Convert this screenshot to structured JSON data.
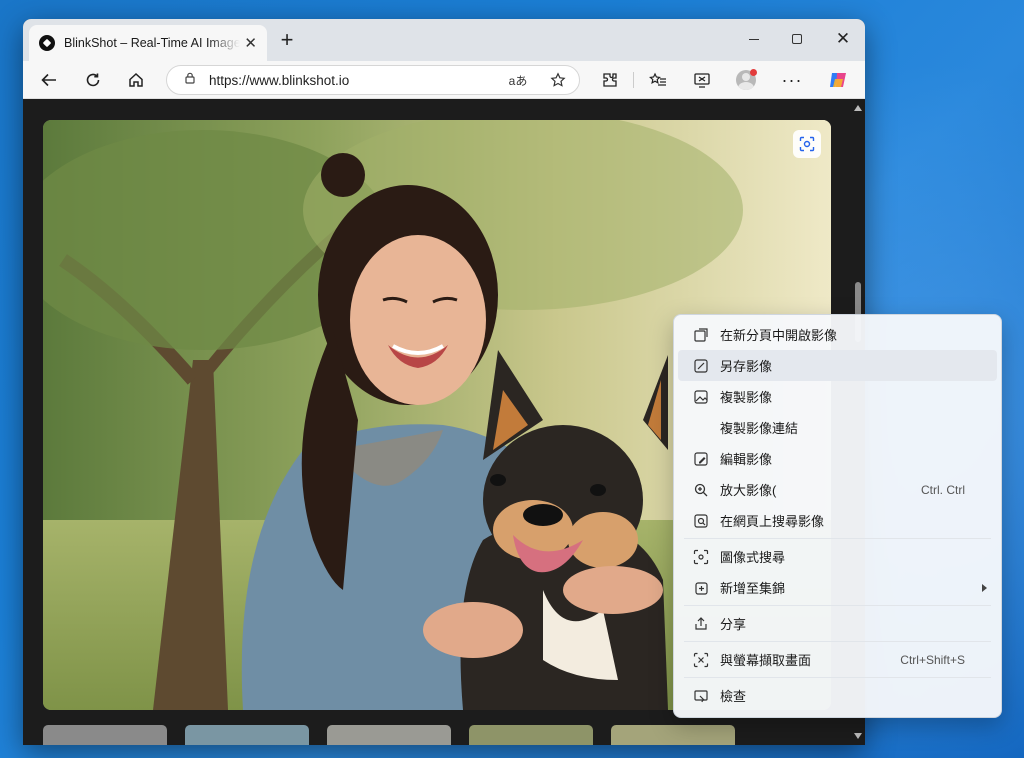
{
  "tab": {
    "title": "BlinkShot – Real-Time AI Image Generator"
  },
  "address": {
    "url": "https://www.blinkshot.io"
  },
  "icons": {
    "back": "back-arrow-icon",
    "refresh": "refresh-icon",
    "home": "home-icon",
    "lock": "site-info-icon",
    "read_aloud": "read-aloud-icon",
    "favorite": "star-icon",
    "extensions": "extensions-icon",
    "favorites": "favorites-icon",
    "collections": "screenshot-icon",
    "profile": "profile-avatar",
    "more": "more-icon",
    "copilot": "copilot-icon"
  },
  "context_menu": {
    "items": [
      {
        "label": "在新分頁中開啟影像",
        "icon": "open-new-tab-icon"
      },
      {
        "label": "另存影像",
        "icon": "save-image-icon"
      },
      {
        "label": "複製影像",
        "icon": "copy-image-icon"
      },
      {
        "label": "複製影像連結",
        "icon": ""
      },
      {
        "label": "編輯影像",
        "icon": "edit-image-icon"
      },
      {
        "label": "放大影像(",
        "icon": "zoom-icon",
        "shortcut": "Ctrl. Ctrl"
      },
      {
        "label": "在網頁上搜尋影像",
        "icon": "search-image-icon"
      },
      {
        "label": "圖像式搜尋",
        "icon": "visual-search-icon"
      },
      {
        "label": "新增至集錦",
        "icon": "add-collection-icon"
      },
      {
        "label": "分享",
        "icon": "share-icon"
      },
      {
        "label": "與螢幕擷取畫面",
        "icon": "screen-capture-icon",
        "shortcut": "Ctrl+Shift+S"
      },
      {
        "label": "檢查",
        "icon": "inspect-icon"
      }
    ]
  },
  "colors": {
    "accent_red": "#e23c3c",
    "menu_bg": "#f6f8fb",
    "desktop_blue": "#1b7fd6"
  }
}
